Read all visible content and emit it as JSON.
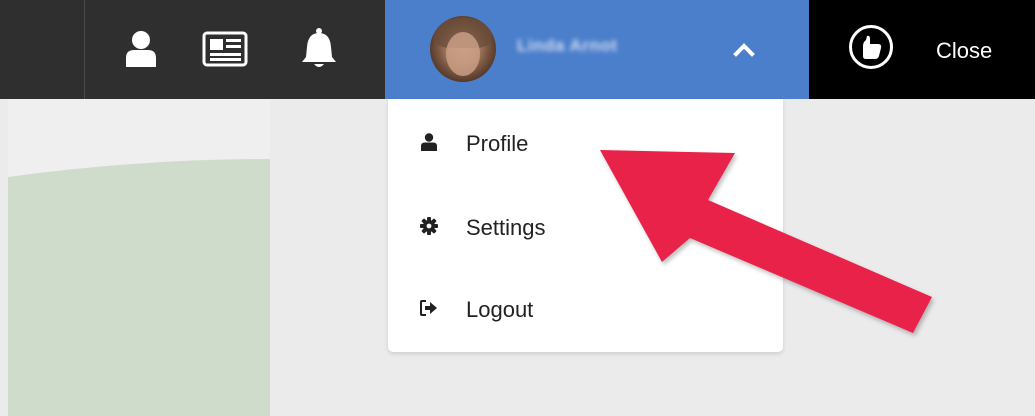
{
  "topbar": {
    "icons": [
      "user-icon",
      "newspaper-icon",
      "bell-icon"
    ],
    "user": {
      "name": "Linda Arnot",
      "menu_state": "expanded"
    },
    "close_label": "Close"
  },
  "dropdown": {
    "items": [
      {
        "label": "Profile",
        "icon": "user-icon"
      },
      {
        "label": "Settings",
        "icon": "gear-icon"
      },
      {
        "label": "Logout",
        "icon": "sign-out-icon"
      }
    ]
  },
  "colors": {
    "topbar_bg": "#2f2f2f",
    "user_menu_bg": "#4c7fcb",
    "close_bg": "#000000",
    "arrow": "#e8224a",
    "page_bg": "#ebebeb",
    "green_panel": "#cfdccb"
  }
}
